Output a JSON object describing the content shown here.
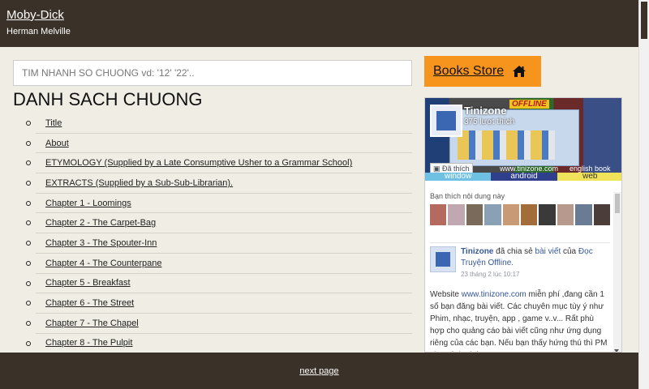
{
  "header": {
    "title": "Moby-Dick",
    "author": "Herman Melville"
  },
  "search": {
    "placeholder": "TIM NHANH SO CHUONG vd: '12' '22'.."
  },
  "list": {
    "title": "DANH SACH CHUONG",
    "items": [
      "Title",
      "About",
      "ETYMOLOGY (Supplied by a Late Consumptive Usher to a Grammar School)",
      "EXTRACTS (Supplied by a Sub-Sub-Librarian).",
      "Chapter 1 - Loomings",
      "Chapter 2 - The Carpet-Bag",
      "Chapter 3 - The Spouter-Inn",
      "Chapter 4 - The Counterpane",
      "Chapter 5 - Breakfast",
      "Chapter 6 - The Street",
      "Chapter 7 - The Chapel",
      "Chapter 8 - The Pulpit"
    ]
  },
  "books_store": {
    "label": "Books Store",
    "icon": "home-icon"
  },
  "facebook": {
    "page_name": "Tinizone",
    "likes": "375 lượt thích",
    "like_button": "Đã thích",
    "cover_offline": "OFFLINE",
    "cover_url": "www.tinizone.com",
    "cover_ebook": "english book",
    "cover_words": [
      "window",
      "android",
      "web"
    ],
    "fans_title": "Bạn thích nội dung này",
    "fan_colors": [
      "#b46a5e",
      "#c0a7b0",
      "#7a6a5a",
      "#8aa0b4",
      "#c99a76",
      "#a26c3b",
      "#3a3a3a",
      "#b79a8c",
      "#6a7c94",
      "#4a3d3a"
    ],
    "post": {
      "author": "Tinizone",
      "shared_text": "đã chia sẻ",
      "link_text": "bài viết",
      "of_text": "của",
      "source": "Đọc Truyện Offline.",
      "time": "23 tháng 2 lúc 10:17",
      "body_prefix": "Website",
      "body_site": "www.tinizone.com",
      "body_text": "miễn phí ,đang cần 1 số bạn đăng bài viết. Các chuyên mục tùy ý như Phim, nhạc, truyện, app , game v..v... Rất phù hợp cho quảng cáo bài viết cũng như ứng dụng riêng của các bạn. Nếu bạn thấy hứng thú thì PM cho mình nhé."
    }
  },
  "footer": {
    "next_label": "next page"
  },
  "colors": {
    "header_bg": "#3a3129",
    "page_bg": "#efede4",
    "accent": "#f7941d"
  }
}
